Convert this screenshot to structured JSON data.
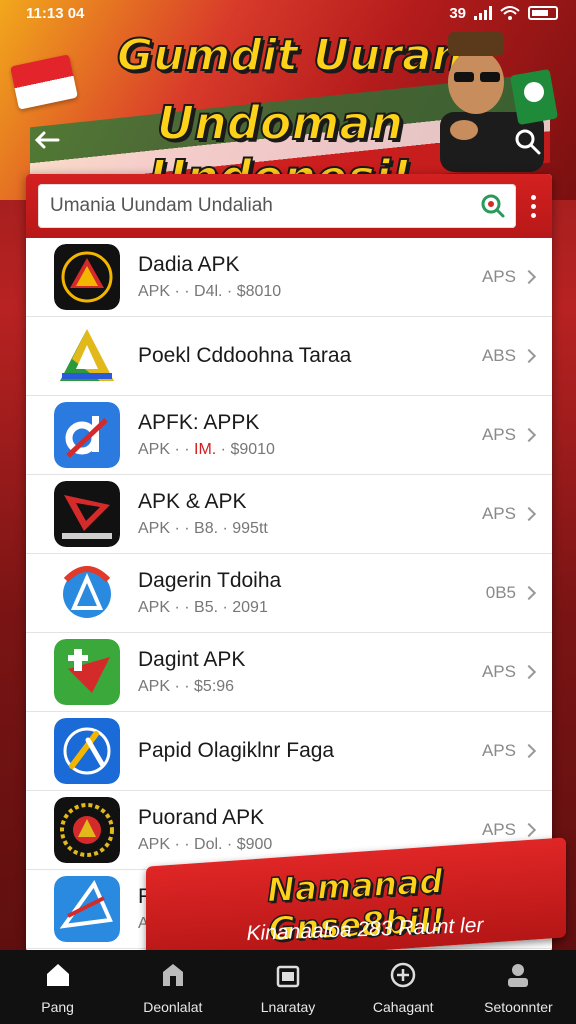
{
  "status_bar": {
    "time": "11:13 04",
    "network": "39"
  },
  "header": {
    "title_line1": "Gumdit Uuran",
    "title_line2": "Undoman Undonesi!"
  },
  "search": {
    "value": "Umania Uundam Undaliah",
    "placeholder": "Umania Uundam Undaliah"
  },
  "apps": [
    {
      "title": "Dadia APK",
      "sub_prefix": "APK · · ",
      "sub_mid": "D4l.",
      "sub_suffix": " · $8010",
      "action": "APS",
      "icon": "black-triangle-emblem",
      "colors": [
        "#111111",
        "#f2b600",
        "#d42a2a"
      ]
    },
    {
      "title": "Poekl Cddoohna Taraa",
      "sub_prefix": "",
      "sub_mid": "",
      "sub_suffix": "",
      "action": "ABS",
      "icon": "tricolor-a-logo",
      "colors": [
        "#ffffff",
        "#2a9a3a",
        "#e2b91a"
      ]
    },
    {
      "title": "APFK: APPK",
      "sub_prefix": "APK · · ",
      "sub_mid": "IM.",
      "sub_suffix": " · $9010",
      "action": "APS",
      "icon": "blue-d-logo",
      "colors": [
        "#2a7ae0",
        "#ffffff",
        "#d42a2a"
      ]
    },
    {
      "title": "APK & APK",
      "sub_prefix": "APK · · ",
      "sub_mid": "B8.",
      "sub_suffix": " · 995tt",
      "action": "APS",
      "icon": "red-arrow-emblem",
      "colors": [
        "#111111",
        "#d42a2a",
        "#ffffff"
      ]
    },
    {
      "title": "Dagerin Tdoiha",
      "sub_prefix": "APK · · ",
      "sub_mid": "B5.",
      "sub_suffix": " · 2091",
      "action": "0B5",
      "icon": "rainbow-a-logo",
      "colors": [
        "#ffffff",
        "#2a8ae0",
        "#e23a2a"
      ]
    },
    {
      "title": "Dagint APK",
      "sub_prefix": "APK · · ",
      "sub_mid": "",
      "sub_suffix": "$5:96",
      "action": "APS",
      "icon": "green-play-logo",
      "colors": [
        "#3aa83a",
        "#d42a2a",
        "#ffffff"
      ]
    },
    {
      "title": "Papid Olagiklnr Faga",
      "sub_prefix": "",
      "sub_mid": "",
      "sub_suffix": "",
      "action": "APS",
      "icon": "blue-circle-logo",
      "colors": [
        "#1a6ad8",
        "#ffffff",
        "#f2b600"
      ]
    },
    {
      "title": "Puorand APK",
      "sub_prefix": "APK · · ",
      "sub_mid": "Dol.",
      "sub_suffix": " · $900",
      "action": "APS",
      "icon": "gold-wreath-emblem",
      "colors": [
        "#111111",
        "#e2b91a",
        "#d42a2a"
      ]
    },
    {
      "title": "Re",
      "sub_prefix": "AP",
      "sub_mid": "",
      "sub_suffix": "",
      "action": "",
      "icon": "blue-kite-logo",
      "colors": [
        "#2a8ae0",
        "#ffffff",
        "#d42a2a"
      ]
    }
  ],
  "promo": {
    "line1": "Namanad Gnse8bil!",
    "line2": "Kinanaaloa 283 Raunt ler"
  },
  "bottom_nav": [
    {
      "label": "Pang",
      "icon": "home-icon"
    },
    {
      "label": "Deonlalat",
      "icon": "store-icon"
    },
    {
      "label": "Lnaratay",
      "icon": "library-icon"
    },
    {
      "label": "Cahagant",
      "icon": "add-circle-icon"
    },
    {
      "label": "Setoonnter",
      "icon": "profile-icon"
    }
  ],
  "theme": {
    "primary": "#d42020",
    "accent": "#ffd21a",
    "nav_bg": "#111111"
  }
}
